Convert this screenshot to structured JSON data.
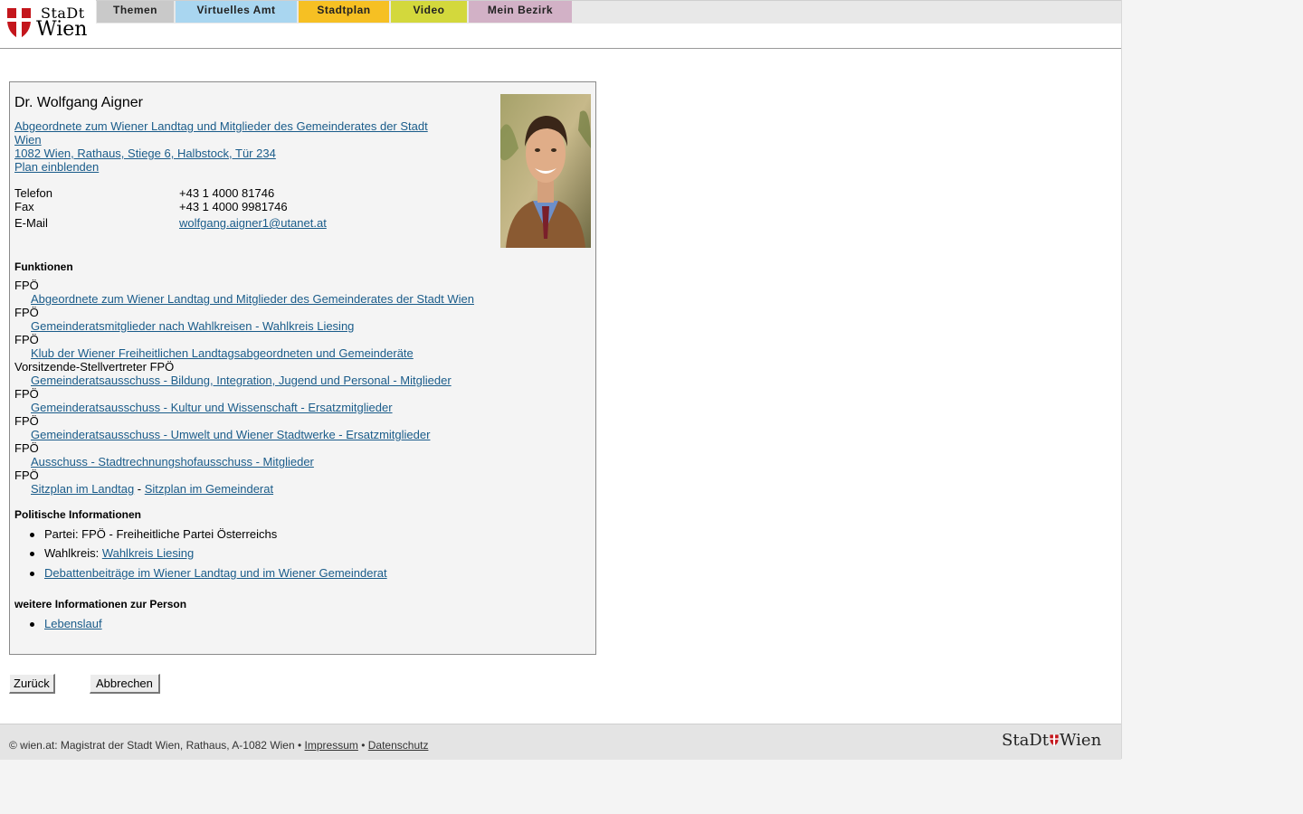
{
  "header": {
    "logo_text_top": "StaDt",
    "logo_text_bottom": "Wien",
    "tabs": [
      {
        "label": "Themen",
        "color": "#c9c9c9"
      },
      {
        "label": "Virtuelles Amt",
        "color": "#a9d6f0"
      },
      {
        "label": "Stadtplan",
        "color": "#f6c023"
      },
      {
        "label": "Video",
        "color": "#d3d83c"
      },
      {
        "label": "Mein Bezirk",
        "color": "#d2b1c6"
      }
    ]
  },
  "person": {
    "name": "Dr. Wolfgang Aigner",
    "role_link_line1": "Abgeordnete zum Wiener Landtag und Mitglieder des Gemeinderates der Stadt",
    "role_link_line2": "Wien ",
    "address_link": "1082 Wien, Rathaus, Stiege 6, Halbstock, Tür 234",
    "plan_link": "Plan einblenden",
    "contacts": [
      {
        "label": "Telefon",
        "value": "+43 1 4000 81746"
      },
      {
        "label": "Fax",
        "value": "+43 1 4000 9981746"
      },
      {
        "label": "E-Mail",
        "value": "wolfgang.aigner1@utanet.at"
      }
    ]
  },
  "functions": {
    "title": "Funktionen",
    "items": [
      {
        "role": "FPÖ",
        "link": "Abgeordnete zum Wiener Landtag und Mitglieder des Gemeinderates der Stadt Wien"
      },
      {
        "role": "FPÖ",
        "link": "Gemeinderatsmitglieder nach Wahlkreisen - Wahlkreis Liesing"
      },
      {
        "role": "FPÖ",
        "link": "Klub der Wiener Freiheitlichen Landtagsabgeordneten und Gemeinderäte"
      },
      {
        "role": "Vorsitzende-Stellvertreter FPÖ",
        "link": "Gemeinderatsausschuss - Bildung, Integration, Jugend und Personal - Mitglieder"
      },
      {
        "role": "FPÖ",
        "link": "Gemeinderatsausschuss - Kultur und Wissenschaft - Ersatzmitglieder"
      },
      {
        "role": "FPÖ",
        "link": "Gemeinderatsausschuss - Umwelt und Wiener Stadtwerke - Ersatzmitglieder"
      },
      {
        "role": "FPÖ",
        "link": "Ausschuss - Stadtrechnungshofausschuss - Mitglieder"
      },
      {
        "role": "FPÖ",
        "link": ""
      }
    ],
    "seat_landtag": "Sitzplan im Landtag",
    "seat_separator": " - ",
    "seat_gemeinderat": "Sitzplan im Gemeinderat"
  },
  "political": {
    "title": "Politische Informationen",
    "party": "Partei: FPÖ - Freiheitliche Partei Österreichs",
    "district_label": "Wahlkreis: ",
    "district_link": "Wahlkreis Liesing",
    "debates_link": "Debattenbeiträge im Wiener Landtag und im Wiener Gemeinderat"
  },
  "more": {
    "title": "weitere Informationen zur Person",
    "cv_link": "Lebenslauf"
  },
  "buttons": {
    "back": "Zurück",
    "cancel": "Abbrechen"
  },
  "footer": {
    "copyright": "© wien.at: Magistrat der Stadt Wien, Rathaus, A-1082 Wien",
    "sep1": " • ",
    "impressum": "Impressum",
    "sep2": " • ",
    "datenschutz": "Datenschutz",
    "logo_left": "StaDt",
    "logo_right": "Wien"
  },
  "colors": {
    "link": "#1a5c8a",
    "shield_red": "#c4161c"
  }
}
